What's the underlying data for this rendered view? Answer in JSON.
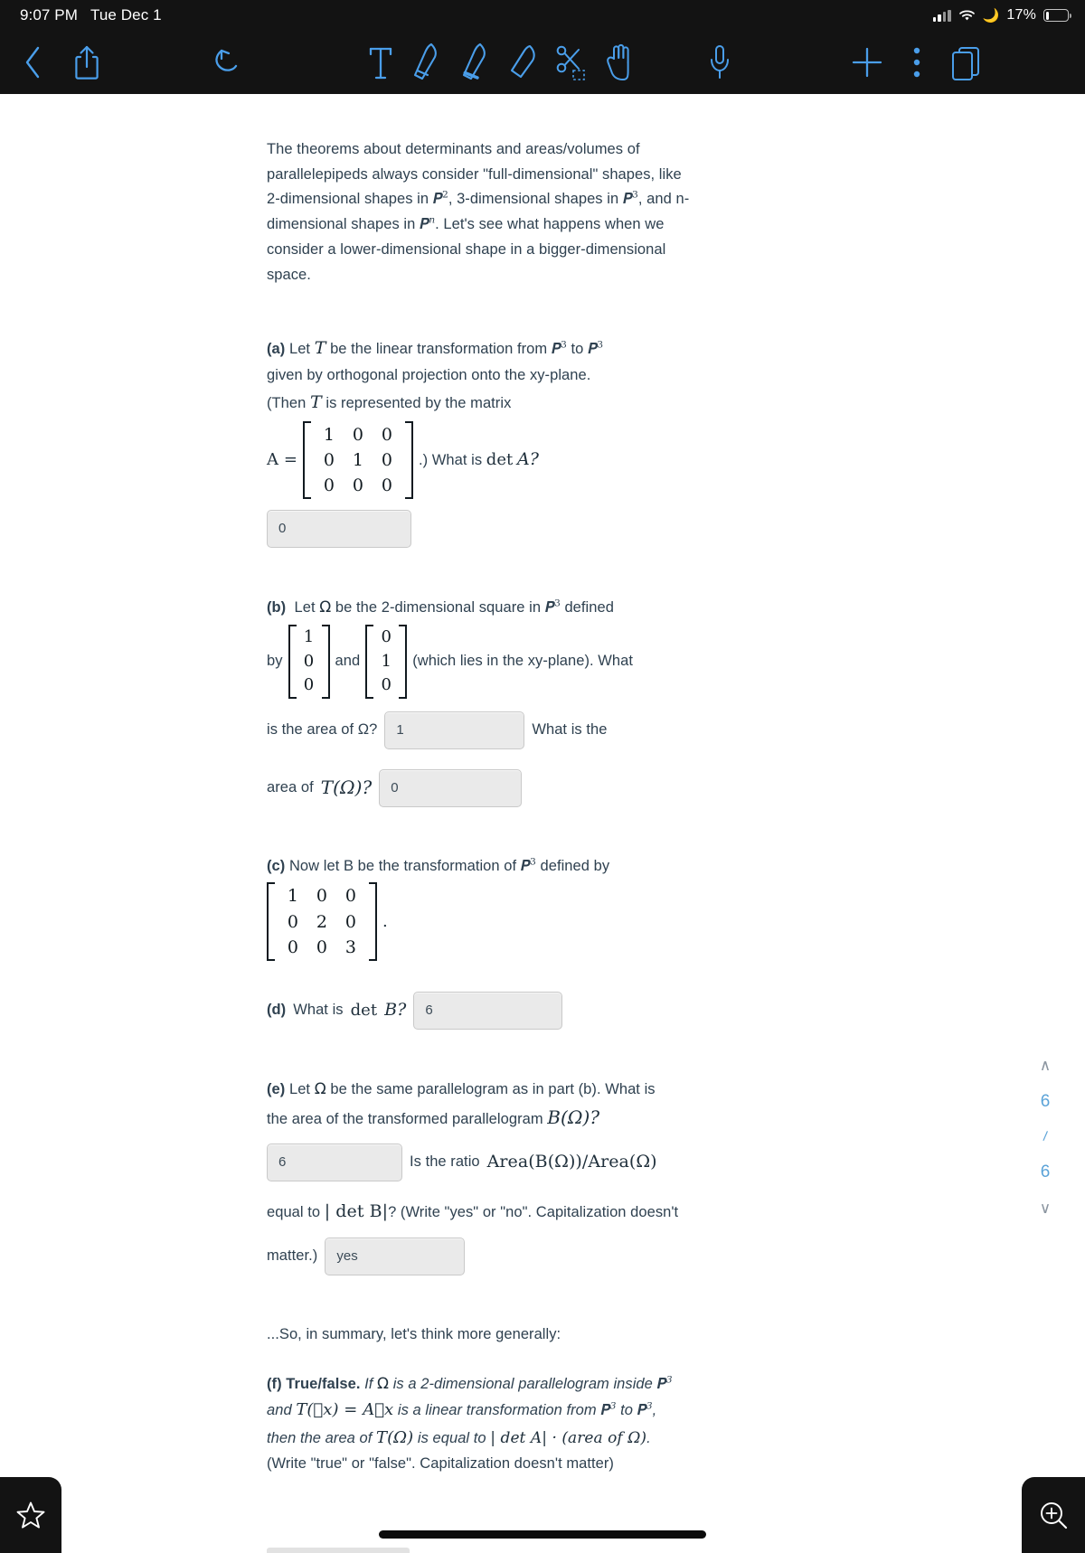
{
  "status_bar": {
    "time": "9:07 PM",
    "date": "Tue Dec 1",
    "battery_percent": "17%",
    "battery_level": 17,
    "icons": [
      "cellular-signal-icon",
      "wifi-icon",
      "moon-icon",
      "battery-icon"
    ]
  },
  "toolbar": {
    "items": [
      {
        "name": "back-button",
        "icon": "chevron-left-icon"
      },
      {
        "name": "share-button",
        "icon": "share-icon"
      },
      {
        "name": "undo-button",
        "icon": "undo-arrow-icon"
      },
      {
        "name": "text-tool",
        "icon": "text-t-icon"
      },
      {
        "name": "pen-tool",
        "icon": "pen-icon"
      },
      {
        "name": "highlighter-tool",
        "icon": "highlighter-icon"
      },
      {
        "name": "eraser-tool",
        "icon": "eraser-icon"
      },
      {
        "name": "lasso-tool",
        "icon": "scissors-selection-icon"
      },
      {
        "name": "hand-tool",
        "icon": "hand-icon"
      },
      {
        "name": "microphone-button",
        "icon": "microphone-icon"
      },
      {
        "name": "add-button",
        "icon": "plus-icon"
      },
      {
        "name": "more-button",
        "icon": "ellipsis-vertical-icon"
      },
      {
        "name": "pages-button",
        "icon": "pages-stack-icon"
      }
    ],
    "accent_color": "#4a9eea",
    "bar_color": "#131313"
  },
  "document": {
    "intro": {
      "text": "The theorems about determinants and areas/volumes of parallelepipeds always consider \"full-dimensional\" shapes, like 2-dimensional shapes in",
      "part2": ", 3-dimensional shapes in",
      "part3": ", and n-dimensional shapes in",
      "part4": ". Let's see what happens when we consider a lower-dimensional shape in a bigger-dimensional space.",
      "exp_2": "2",
      "exp_3": "3",
      "exp_n": "n"
    },
    "part_a": {
      "label": "(a)",
      "line1_pre": "Let",
      "T": "T",
      "line1_mid": "be the linear transformation from",
      "line1_to": "to",
      "exp": "3",
      "line2": "given by orthogonal projection onto the xy-plane.",
      "line3_pre": "(Then",
      "line3_post": "is represented by the matrix",
      "matrix_label": "A =",
      "matrix": [
        [
          "1",
          "0",
          "0"
        ],
        [
          "0",
          "1",
          "0"
        ],
        [
          "0",
          "0",
          "0"
        ]
      ],
      "question": ".) What is",
      "det": "det",
      "det_var": "A?",
      "answer": "0"
    },
    "part_b": {
      "label": "(b)",
      "line1_pre": "Let",
      "omega": "Ω",
      "line1_post": "be the 2-dimensional square in",
      "exp": "3",
      "line1_end": "defined",
      "by": "by",
      "vec1": [
        "1",
        "0",
        "0"
      ],
      "and": "and",
      "vec2": [
        "0",
        "1",
        "0"
      ],
      "line2_post": "(which lies in the xy-plane). What",
      "q1": "is the area of Ω?",
      "answer1": "1",
      "q1_tail": "What is the",
      "q2_pre": "area of",
      "q2_math": "T(Ω)?",
      "answer2": "0"
    },
    "part_c": {
      "label": "(c)",
      "line1": "Now let B be the transformation of",
      "exp": "3",
      "line1_end": "defined by",
      "matrix": [
        [
          "1",
          "0",
          "0"
        ],
        [
          "0",
          "2",
          "0"
        ],
        [
          "0",
          "0",
          "3"
        ]
      ],
      "period": "."
    },
    "part_d": {
      "label": "(d)",
      "text": "What is",
      "det": "det",
      "det_var": "B?",
      "answer": "6"
    },
    "part_e": {
      "label": "(e)",
      "line1_pre": "Let",
      "omega": "Ω",
      "line1_post": "be the same parallelogram as in part (b). What is",
      "line2_pre": "the area of the transformed parallelogram",
      "line2_math": "B(Ω)?",
      "answer1": "6",
      "ratio_text": "Is the ratio",
      "ratio_math": "Area(B(Ω))/Area(Ω)",
      "line3_pre": "equal to",
      "line3_math": "| det B|",
      "line3_post": "? (Write \"yes\" or \"no\". Capitalization doesn't",
      "line4": "matter.)",
      "answer2": "yes"
    },
    "summary": "...So, in summary, let's think more generally:",
    "part_f": {
      "label": "(f)",
      "heading": "True/false.",
      "line1_pre": "If",
      "omega": "Ω",
      "line1_post": "is a 2-dimensional parallelogram inside",
      "exp": "3",
      "line2_pre": "and",
      "line2_math": "T(⃗x) = A⃗x",
      "line2_mid": "is a linear transformation from",
      "line2_to": "to",
      "line2_end": ",",
      "line3_pre": "then the area of",
      "line3_math1": "T(Ω)",
      "line3_mid": "is equal to",
      "line3_math2": "| det A| · (area of Ω)",
      "line3_end": ".",
      "line4": "(Write \"true\" or \"false\". Capitalization doesn't matter)"
    }
  },
  "side_rail": {
    "up_chevron": "∧",
    "value_top": "6",
    "separator": "/",
    "value_bottom": "6",
    "down_chevron": "∨"
  },
  "bottom_bar": {
    "bookmark_icon": "star-outline-icon",
    "zoom_icon": "zoom-in-magnifier-icon"
  }
}
